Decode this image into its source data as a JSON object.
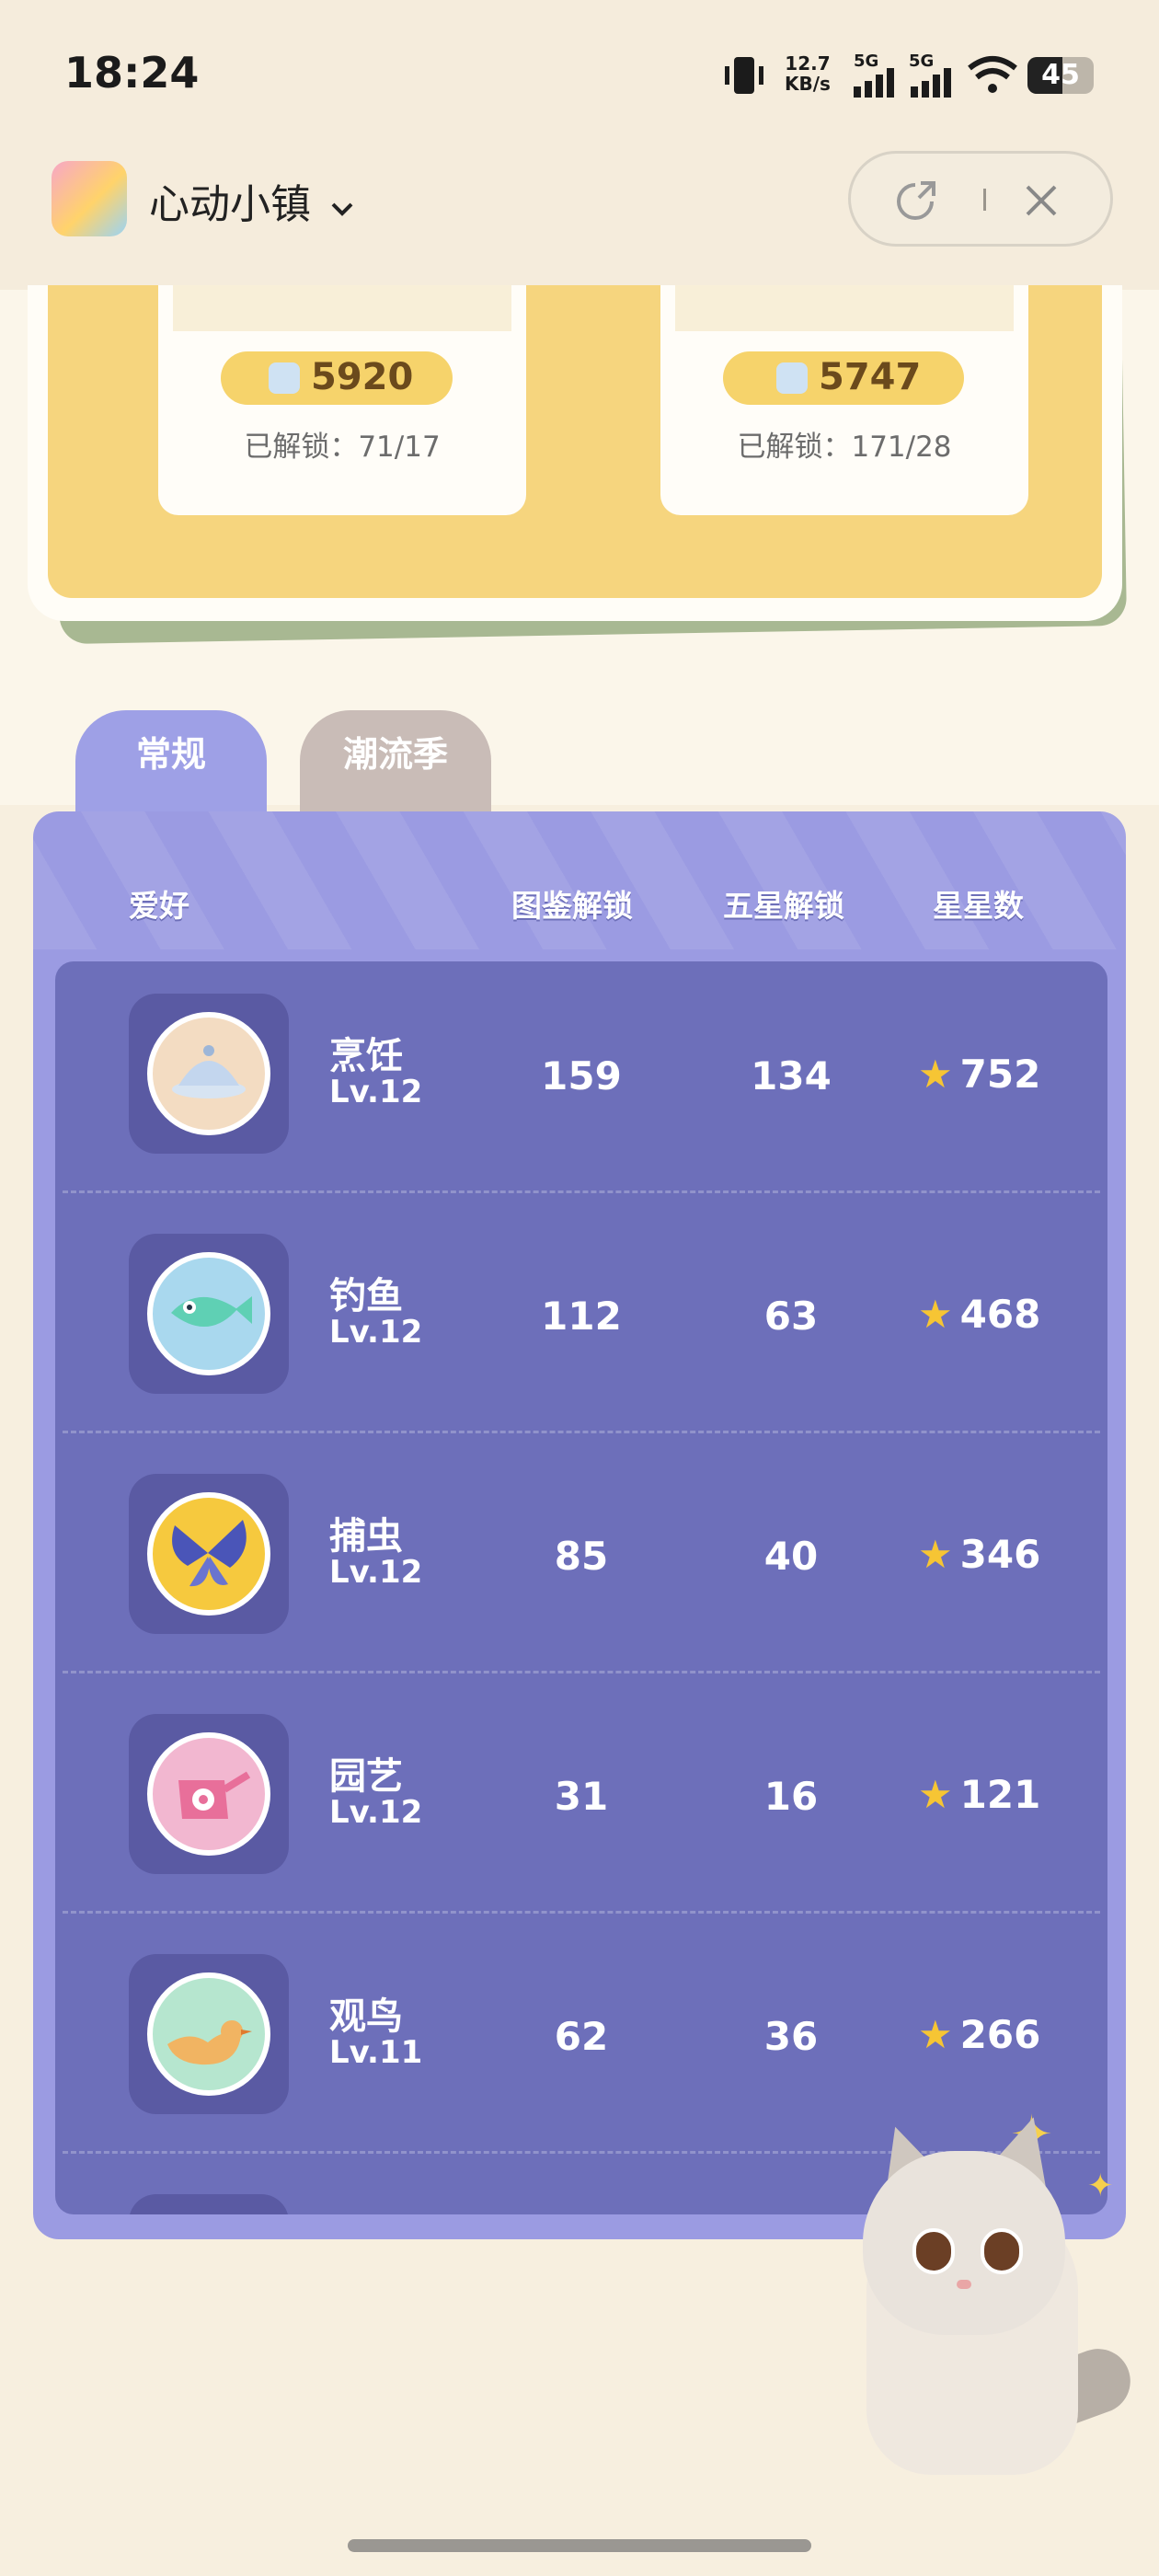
{
  "status_bar": {
    "time": "18:24",
    "net_speed_value": "12.7",
    "net_speed_unit": "KB/s",
    "sim1_label": "5G",
    "sim2_label": "5G",
    "battery": "45"
  },
  "title_bar": {
    "app_name": "心动小镇",
    "dropdown_icon": "chevron-down-icon",
    "share_icon": "share-arrow-icon",
    "close_icon": "close-icon"
  },
  "shop_cards": [
    {
      "price": "5920",
      "unlock_text": "已解锁：71/17"
    },
    {
      "price": "5747",
      "unlock_text": "已解锁：171/28"
    }
  ],
  "tabs": [
    {
      "label": "常规",
      "active": true
    },
    {
      "label": "潮流季",
      "active": false
    }
  ],
  "table": {
    "headers": {
      "hobby": "爱好",
      "collection": "图鉴解锁",
      "five_star": "五星解锁",
      "stars": "星星数"
    },
    "rows": [
      {
        "name": "烹饪",
        "level": "Lv.12",
        "collection": "159",
        "five_star": "134",
        "stars": "752",
        "icon": "cooking-dish-icon",
        "color": "#f3dcc2"
      },
      {
        "name": "钓鱼",
        "level": "Lv.12",
        "collection": "112",
        "five_star": "63",
        "stars": "468",
        "icon": "fishing-fish-icon",
        "color": "#a9d8ee"
      },
      {
        "name": "捕虫",
        "level": "Lv.12",
        "collection": "85",
        "five_star": "40",
        "stars": "346",
        "icon": "butterfly-icon",
        "color": "#f6c93e"
      },
      {
        "name": "园艺",
        "level": "Lv.12",
        "collection": "31",
        "five_star": "16",
        "stars": "121",
        "icon": "watering-can-icon",
        "color": "#f2b7d0"
      },
      {
        "name": "观鸟",
        "level": "Lv.11",
        "collection": "62",
        "five_star": "36",
        "stars": "266",
        "icon": "bird-icon",
        "color": "#b6e6cf"
      }
    ]
  },
  "colors": {
    "panel": "#9b9be2",
    "list": "#6d6fba",
    "star": "#f6c534",
    "card_yellow": "#f6d57e"
  }
}
